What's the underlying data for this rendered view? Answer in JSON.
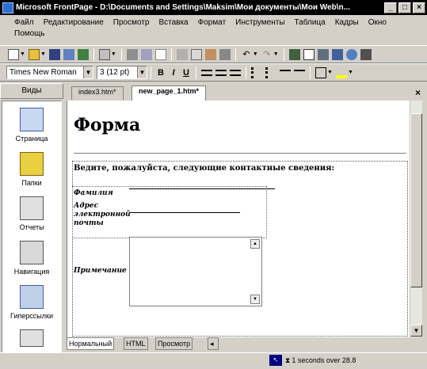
{
  "titlebar": {
    "app": "Microsoft FrontPage - D:\\Documents and Settings\\Maksim\\Мои документы\\Мои Web\\n...",
    "minimize": "_",
    "maximize": "□",
    "close": "×"
  },
  "menu": [
    "Файл",
    "Редактирование",
    "Просмотр",
    "Вставка",
    "Формат",
    "Инструменты",
    "Таблица",
    "Кадры",
    "Окно",
    "Помощь"
  ],
  "format_toolbar": {
    "font": "Times New Roman",
    "size": "3 (12 pt)",
    "bold": "B",
    "italic": "I",
    "underline": "U"
  },
  "views": {
    "title": "Виды",
    "items": [
      {
        "label": "Страница",
        "icon": "page-icon"
      },
      {
        "label": "Папки",
        "icon": "folder-icon"
      },
      {
        "label": "Отчеты",
        "icon": "reports-icon"
      },
      {
        "label": "Навигация",
        "icon": "navigation-icon"
      },
      {
        "label": "Гиперссылки",
        "icon": "hyperlinks-icon"
      }
    ]
  },
  "tabs": [
    {
      "label": "index3.htm*",
      "active": false
    },
    {
      "label": "new_page_1.htm*",
      "active": true
    }
  ],
  "document": {
    "heading": "Форма",
    "intro": "Ведите, пожалуйста, следующие контактные сведения:",
    "fields": {
      "surname": "Фамилия",
      "email": "Адрес электронной почты",
      "notes": "Примечание"
    }
  },
  "bottom_tabs": [
    "Нормальный",
    "HTML",
    "Просмотр"
  ],
  "status": {
    "timer": "1 seconds over 28.8"
  }
}
